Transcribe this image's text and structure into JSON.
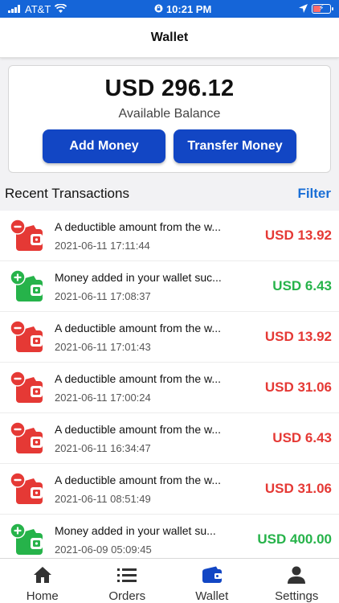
{
  "status_bar": {
    "carrier": "AT&T",
    "time": "10:21 PM"
  },
  "header": {
    "title": "Wallet"
  },
  "balance": {
    "amount": "USD 296.12",
    "label": "Available Balance",
    "add_money_label": "Add Money",
    "transfer_money_label": "Transfer Money"
  },
  "recent": {
    "title": "Recent Transactions",
    "filter_label": "Filter"
  },
  "colors": {
    "debit": "#e53935",
    "credit": "#26b34a",
    "accent": "#1246c4"
  },
  "transactions": [
    {
      "type": "debit",
      "title": "A deductible amount from the w...",
      "date": "2021-06-11 17:11:44",
      "amount": "USD 13.92"
    },
    {
      "type": "credit",
      "title": "Money added in your wallet suc...",
      "date": "2021-06-11 17:08:37",
      "amount": "USD 6.43"
    },
    {
      "type": "debit",
      "title": "A deductible amount from the w...",
      "date": "2021-06-11 17:01:43",
      "amount": "USD 13.92"
    },
    {
      "type": "debit",
      "title": "A deductible amount from the w...",
      "date": "2021-06-11 17:00:24",
      "amount": "USD 31.06"
    },
    {
      "type": "debit",
      "title": "A deductible amount from the w...",
      "date": "2021-06-11 16:34:47",
      "amount": "USD 6.43"
    },
    {
      "type": "debit",
      "title": "A deductible amount from the w...",
      "date": "2021-06-11 08:51:49",
      "amount": "USD 31.06"
    },
    {
      "type": "credit",
      "title": "Money added in your wallet su...",
      "date": "2021-06-09 05:09:45",
      "amount": "USD 400.00"
    }
  ],
  "nav": {
    "items": [
      {
        "label": "Home",
        "icon": "home-icon"
      },
      {
        "label": "Orders",
        "icon": "list-icon"
      },
      {
        "label": "Wallet",
        "icon": "wallet-icon"
      },
      {
        "label": "Settings",
        "icon": "person-icon"
      }
    ],
    "active_index": 2
  }
}
